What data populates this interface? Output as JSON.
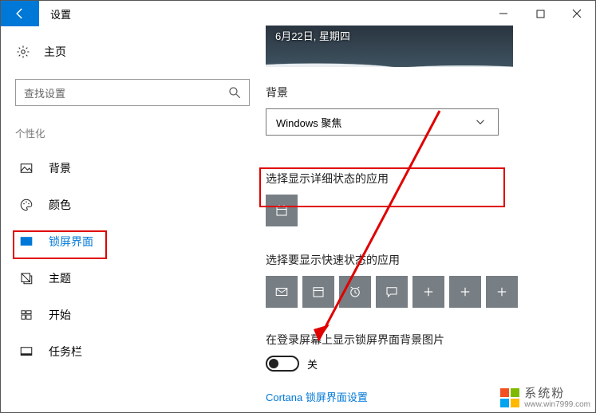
{
  "titlebar": {
    "title": "设置"
  },
  "sidebar": {
    "home": "主页",
    "search_placeholder": "查找设置",
    "section": "个性化",
    "items": [
      {
        "label": "背景"
      },
      {
        "label": "颜色"
      },
      {
        "label": "锁屏界面"
      },
      {
        "label": "主题"
      },
      {
        "label": "开始"
      },
      {
        "label": "任务栏"
      }
    ]
  },
  "main": {
    "preview_date": "6月22日, 星期四",
    "background_label": "背景",
    "background_select": "Windows 聚焦",
    "detailed_label": "选择显示详细状态的应用",
    "quick_label": "选择要显示快速状态的应用",
    "login_bg_label": "在登录屏幕上显示锁屏界面背景图片",
    "login_bg_state": "关",
    "cortana_link": "Cortana 锁屏界面设置"
  },
  "watermark": {
    "brand": "系统粉",
    "url": "www.win7999.com"
  }
}
